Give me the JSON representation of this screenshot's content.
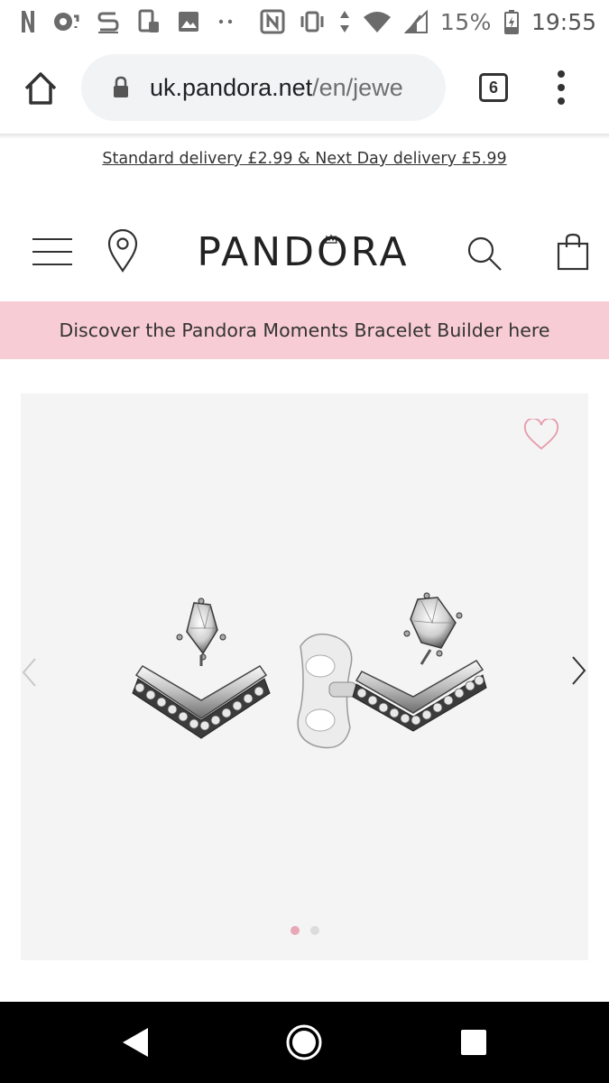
{
  "status_bar": {
    "battery": "15%",
    "time": "19:55",
    "icons": [
      "netflix-icon",
      "camera-icon",
      "s-app-icon",
      "device-icon",
      "gallery-icon",
      "more-dots-icon",
      "nfc-icon",
      "vibrate-icon",
      "data-arrows-icon",
      "wifi-icon",
      "signal-icon",
      "battery-icon"
    ]
  },
  "browser": {
    "url_domain": "uk.pandora.net",
    "url_path": "/en/jewe",
    "tab_count": "6",
    "icons": [
      "home-icon",
      "lock-icon",
      "more-vert-icon"
    ]
  },
  "promo": {
    "delivery_text": "Standard delivery £2.99 & Next Day delivery £5.99"
  },
  "header": {
    "logo": "PANDORA",
    "icons": [
      "menu-icon",
      "map-pin-icon",
      "search-icon",
      "shopping-bag-icon"
    ]
  },
  "banner": {
    "text": "Discover the Pandora Moments Bracelet Builder here",
    "color": "#f8ccd4"
  },
  "gallery": {
    "current_slide": 1,
    "total_slides": 2,
    "accent": "#e8a7b6",
    "icons": [
      "heart-icon",
      "chevron-left-icon",
      "chevron-right-icon"
    ]
  },
  "android_nav": {
    "icons": [
      "back-icon",
      "home-circle-icon",
      "recents-icon"
    ]
  }
}
